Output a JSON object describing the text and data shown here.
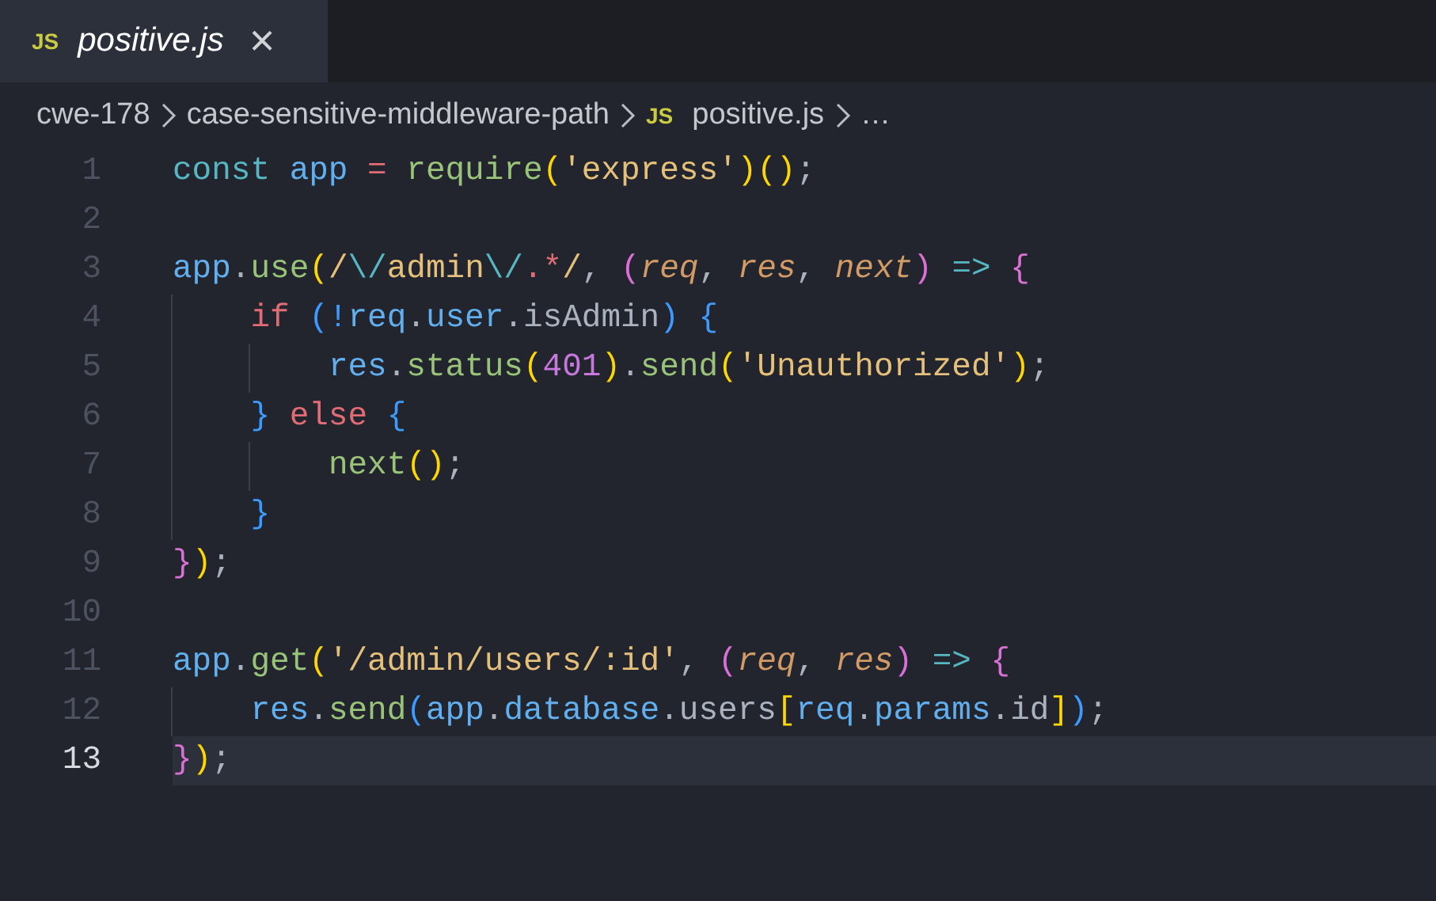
{
  "tabs": [
    {
      "icon_label": "JS",
      "label": "positive.js",
      "selected": true,
      "close": "×"
    }
  ],
  "breadcrumbs": {
    "items": [
      {
        "label": "cwe-178"
      },
      {
        "label": "case-sensitive-middleware-path"
      },
      {
        "label": "positive.js",
        "icon_label": "JS"
      }
    ],
    "more": "…"
  },
  "lines": [
    {
      "number": "1",
      "current": false,
      "tokens": [
        {
          "text": "const",
          "color": "#56b6c2"
        },
        {
          "text": " app",
          "color": "#61afef"
        },
        {
          "text": " =",
          "color": "#e06c75"
        },
        {
          "text": " require",
          "color": "#98c379"
        },
        {
          "text": "(",
          "color": "#ffd700"
        },
        {
          "text": "'express'",
          "color": "#e5c07b"
        },
        {
          "text": ")()",
          "color": "#ffd700"
        },
        {
          "text": ";",
          "color": "#abb2bf"
        }
      ]
    },
    {
      "number": "2",
      "current": false
    },
    {
      "number": "3",
      "current": false,
      "tokens": [
        {
          "text": "app",
          "color": "#61afef"
        },
        {
          "text": ".",
          "color": "#abb2bf"
        },
        {
          "text": "use",
          "color": "#98c379"
        },
        {
          "text": "(",
          "color": "#ffd700"
        },
        {
          "text": "/",
          "color": "#e5c07b"
        },
        {
          "text": "\\/",
          "color": "#56b6c2"
        },
        {
          "text": "admin",
          "color": "#e5c07b"
        },
        {
          "text": "\\/",
          "color": "#56b6c2"
        },
        {
          "text": ".*",
          "color": "#e06c75"
        },
        {
          "text": "/",
          "color": "#e5c07b"
        },
        {
          "text": ",",
          "color": "#abb2bf"
        },
        {
          "text": " (",
          "color": "#da70d6"
        },
        {
          "text": "req",
          "color": "#d19a66",
          "italic": true
        },
        {
          "text": ",",
          "color": "#abb2bf"
        },
        {
          "text": " res",
          "color": "#d19a66",
          "italic": true
        },
        {
          "text": ",",
          "color": "#abb2bf"
        },
        {
          "text": " next",
          "color": "#d19a66",
          "italic": true
        },
        {
          "text": ")",
          "color": "#da70d6"
        },
        {
          "text": " =>",
          "color": "#56b6c2"
        },
        {
          "text": " {",
          "color": "#da70d6"
        }
      ]
    },
    {
      "number": "4",
      "current": false,
      "tokens": [
        {
          "text": "    if",
          "color": "#e06c75"
        },
        {
          "text": " (!",
          "color": "#3d9bff"
        },
        {
          "text": "req",
          "color": "#61afef"
        },
        {
          "text": ".",
          "color": "#abb2bf"
        },
        {
          "text": "user",
          "color": "#61afef"
        },
        {
          "text": ".",
          "color": "#abb2bf"
        },
        {
          "text": "isAdmin",
          "color": "#abb2bf"
        },
        {
          "text": ")",
          "color": "#3d9bff"
        },
        {
          "text": " {",
          "color": "#3d9bff"
        }
      ]
    },
    {
      "number": "5",
      "current": false,
      "tokens": [
        {
          "text": "        res",
          "color": "#61afef"
        },
        {
          "text": ".",
          "color": "#abb2bf"
        },
        {
          "text": "status",
          "color": "#98c379"
        },
        {
          "text": "(",
          "color": "#ffd700"
        },
        {
          "text": "401",
          "color": "#c678dd"
        },
        {
          "text": ")",
          "color": "#ffd700"
        },
        {
          "text": ".",
          "color": "#abb2bf"
        },
        {
          "text": "send",
          "color": "#98c379"
        },
        {
          "text": "(",
          "color": "#ffd700"
        },
        {
          "text": "'Unauthorized'",
          "color": "#e5c07b"
        },
        {
          "text": ")",
          "color": "#ffd700"
        },
        {
          "text": ";",
          "color": "#abb2bf"
        }
      ]
    },
    {
      "number": "6",
      "current": false,
      "tokens": [
        {
          "text": "    }",
          "color": "#3d9bff"
        },
        {
          "text": " else",
          "color": "#e06c75"
        },
        {
          "text": " {",
          "color": "#3d9bff"
        }
      ]
    },
    {
      "number": "7",
      "current": false,
      "tokens": [
        {
          "text": "        next",
          "color": "#98c379"
        },
        {
          "text": "()",
          "color": "#ffd700"
        },
        {
          "text": ";",
          "color": "#abb2bf"
        }
      ]
    },
    {
      "number": "8",
      "current": false,
      "tokens": [
        {
          "text": "    }",
          "color": "#3d9bff"
        }
      ]
    },
    {
      "number": "9",
      "current": false,
      "tokens": [
        {
          "text": "}",
          "color": "#da70d6"
        },
        {
          "text": ")",
          "color": "#ffd700"
        },
        {
          "text": ";",
          "color": "#abb2bf"
        }
      ]
    },
    {
      "number": "10",
      "current": false
    },
    {
      "number": "11",
      "current": false,
      "tokens": [
        {
          "text": "app",
          "color": "#61afef"
        },
        {
          "text": ".",
          "color": "#abb2bf"
        },
        {
          "text": "get",
          "color": "#98c379"
        },
        {
          "text": "(",
          "color": "#ffd700"
        },
        {
          "text": "'/admin/users/:id'",
          "color": "#e5c07b"
        },
        {
          "text": ",",
          "color": "#abb2bf"
        },
        {
          "text": " (",
          "color": "#da70d6"
        },
        {
          "text": "req",
          "color": "#d19a66",
          "italic": true
        },
        {
          "text": ",",
          "color": "#abb2bf"
        },
        {
          "text": " res",
          "color": "#d19a66",
          "italic": true
        },
        {
          "text": ")",
          "color": "#da70d6"
        },
        {
          "text": " =>",
          "color": "#56b6c2"
        },
        {
          "text": " {",
          "color": "#da70d6"
        }
      ]
    },
    {
      "number": "12",
      "current": false,
      "tokens": [
        {
          "text": "    res",
          "color": "#61afef"
        },
        {
          "text": ".",
          "color": "#abb2bf"
        },
        {
          "text": "send",
          "color": "#98c379"
        },
        {
          "text": "(",
          "color": "#3d9bff"
        },
        {
          "text": "app",
          "color": "#61afef"
        },
        {
          "text": ".",
          "color": "#abb2bf"
        },
        {
          "text": "database",
          "color": "#61afef"
        },
        {
          "text": ".",
          "color": "#abb2bf"
        },
        {
          "text": "users",
          "color": "#abb2bf"
        },
        {
          "text": "[",
          "color": "#ffd700"
        },
        {
          "text": "req",
          "color": "#61afef"
        },
        {
          "text": ".",
          "color": "#abb2bf"
        },
        {
          "text": "params",
          "color": "#61afef"
        },
        {
          "text": ".",
          "color": "#abb2bf"
        },
        {
          "text": "id",
          "color": "#abb2bf"
        },
        {
          "text": "]",
          "color": "#ffd700"
        },
        {
          "text": ")",
          "color": "#3d9bff"
        },
        {
          "text": ";",
          "color": "#abb2bf"
        }
      ]
    },
    {
      "number": "13",
      "current": true,
      "tokens": [
        {
          "text": "}",
          "color": "#da70d6"
        },
        {
          "text": ")",
          "color": "#ffd700"
        },
        {
          "text": ";",
          "color": "#abb2bf"
        }
      ]
    }
  ]
}
